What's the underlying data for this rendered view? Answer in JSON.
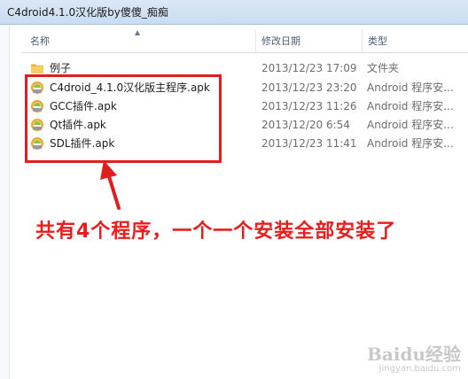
{
  "window": {
    "title": "C4droid4.1.0汉化版by傻傻_痴痴"
  },
  "columns": {
    "name": "名称",
    "date": "修改日期",
    "type": "类型"
  },
  "files": [
    {
      "name": "例子",
      "date": "2013/12/23 17:09",
      "type": "文件夹",
      "icon": "folder-icon"
    },
    {
      "name": "C4droid_4.1.0汉化版主程序.apk",
      "date": "2013/12/23 23:20",
      "type": "Android 程序安...",
      "icon": "apk-icon"
    },
    {
      "name": "GCC插件.apk",
      "date": "2013/12/23 11:26",
      "type": "Android 程序安...",
      "icon": "apk-icon"
    },
    {
      "name": "Qt插件.apk",
      "date": "2013/12/20 6:54",
      "type": "Android 程序安...",
      "icon": "apk-icon"
    },
    {
      "name": "SDL插件.apk",
      "date": "2013/12/23 11:41",
      "type": "Android 程序安...",
      "icon": "apk-icon"
    }
  ],
  "annotation": {
    "text": "共有4个程序，一个一个安装全部安装了",
    "color": "#ee1b1b"
  },
  "watermark": {
    "main": "Baidu经验",
    "sub": "jingyan.baidu.com"
  },
  "colors": {
    "highlight_border": "#e21d1d",
    "folder": "#f3c54b",
    "apk_icon": "#f0a830"
  }
}
